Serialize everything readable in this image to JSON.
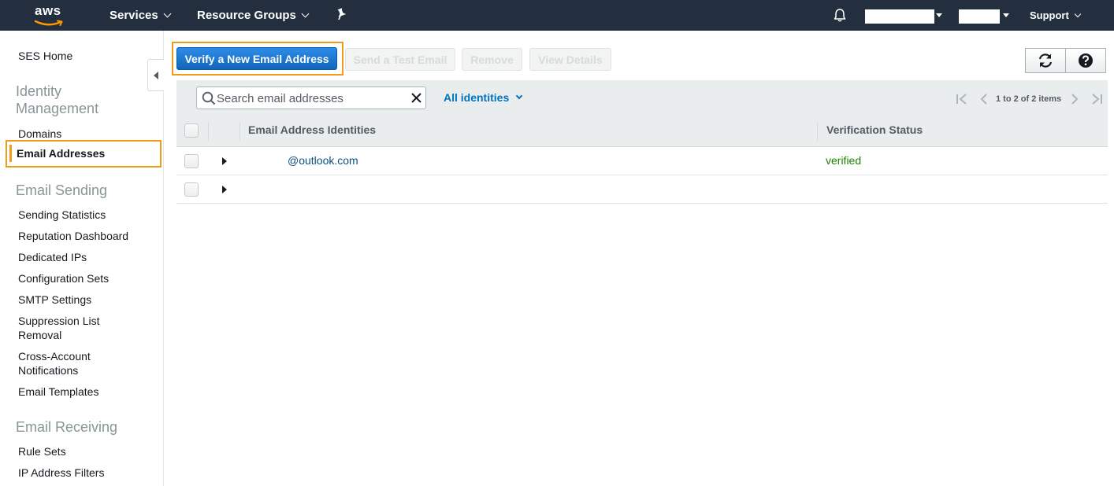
{
  "topnav": {
    "logo_text": "aws",
    "services_label": "Services",
    "resource_groups_label": "Resource Groups",
    "support_label": "Support"
  },
  "sidebar": {
    "ses_home": "SES Home",
    "identity_management": "Identity Management",
    "domains": "Domains",
    "email_addresses": "Email Addresses",
    "email_sending": "Email Sending",
    "sending_items": [
      "Sending Statistics",
      "Reputation Dashboard",
      "Dedicated IPs",
      "Configuration Sets",
      "SMTP Settings",
      "Suppression List Removal",
      "Cross-Account Notifications",
      "Email Templates"
    ],
    "email_receiving": "Email Receiving",
    "receiving_items": [
      "Rule Sets",
      "IP Address Filters"
    ]
  },
  "toolbar": {
    "verify_label": "Verify a New Email Address",
    "send_test_label": "Send a Test Email",
    "remove_label": "Remove",
    "view_details_label": "View Details"
  },
  "filter": {
    "search_placeholder": "Search email addresses",
    "dropdown_label": "All identities",
    "pagination_text": "1 to 2 of 2 items"
  },
  "table": {
    "columns": [
      "Email Address Identities",
      "Verification Status"
    ],
    "rows": [
      {
        "email": "@outlook.com",
        "status": "verified"
      },
      {
        "email": "",
        "status": ""
      }
    ]
  },
  "colors": {
    "nav_bg": "#232f3e",
    "highlight": "#f19b1b",
    "primary": "#1166bb",
    "link": "#0073bb",
    "verified": "#1d8102"
  }
}
